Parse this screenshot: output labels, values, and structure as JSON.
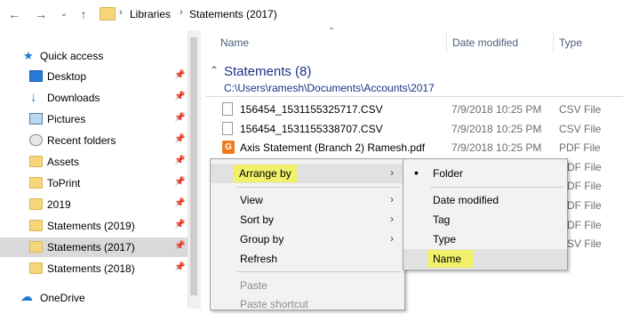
{
  "breadcrumb": [
    "Libraries",
    "Statements (2017)"
  ],
  "sidebar": {
    "quick_access": "Quick access",
    "items": [
      {
        "label": "Desktop",
        "icon": "desktop-icon"
      },
      {
        "label": "Downloads",
        "icon": "download-arrow-icon"
      },
      {
        "label": "Pictures",
        "icon": "pictures-icon"
      },
      {
        "label": "Recent folders",
        "icon": "recent-folders-icon"
      },
      {
        "label": "Assets",
        "icon": "folder-icon"
      },
      {
        "label": "ToPrint",
        "icon": "folder-icon"
      },
      {
        "label": "2019",
        "icon": "folder-icon"
      },
      {
        "label": "Statements (2019)",
        "icon": "folder-icon"
      },
      {
        "label": "Statements (2017)",
        "icon": "folder-icon",
        "selected": true
      },
      {
        "label": "Statements (2018)",
        "icon": "folder-icon"
      }
    ],
    "onedrive": "OneDrive"
  },
  "columns": {
    "name": "Name",
    "date": "Date modified",
    "type": "Type"
  },
  "group": {
    "title": "Statements (8)",
    "path": "C:\\Users\\ramesh\\Documents\\Accounts\\2017"
  },
  "files": [
    {
      "name": "156454_1531155325717.CSV",
      "date": "7/9/2018 10:25 PM",
      "type": "CSV File",
      "kind": "csv"
    },
    {
      "name": "156454_1531155338707.CSV",
      "date": "7/9/2018 10:25 PM",
      "type": "CSV File",
      "kind": "csv"
    },
    {
      "name": "Axis Statement (Branch 2) Ramesh.pdf",
      "date": "7/9/2018 10:25 PM",
      "type": "PDF File",
      "kind": "pdf"
    }
  ],
  "partial_types": [
    "DF File",
    "DF File",
    "DF File",
    "DF File",
    "SV File"
  ],
  "context_menu": {
    "items": [
      "Arrange by",
      "View",
      "Sort by",
      "Group by",
      "Refresh",
      "Paste",
      "Paste shortcut"
    ]
  },
  "submenu": {
    "items": [
      "Folder",
      "Date modified",
      "Tag",
      "Type",
      "Name"
    ],
    "bullet": "•"
  },
  "colors": {
    "highlight": "#f0f06a",
    "group_text": "#1e3287",
    "selected_row": "#d9d9d9"
  }
}
